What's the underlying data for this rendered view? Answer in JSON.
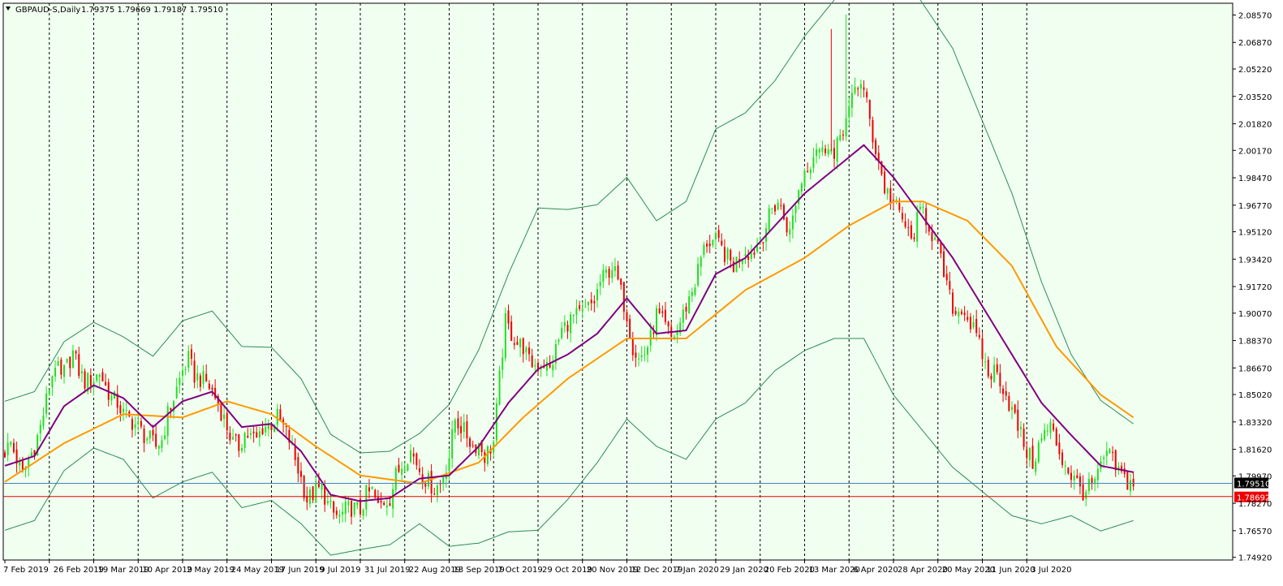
{
  "header": {
    "symbol": "GBPAUD-S,Daily",
    "ohlc": "1.79375 1.79669 1.79187 1.79510"
  },
  "colors": {
    "background": "#F0FFF0",
    "bull": "#22DD22",
    "bear": "#EE0000",
    "ma_fast": "#800080",
    "ma_slow": "#FF9900",
    "bands": "#2E8B57",
    "bid_line": "#4682B4",
    "ask_line": "#EE0000"
  },
  "chart_data": {
    "type": "line",
    "title": "GBPAUD-S,Daily",
    "xlabel": "",
    "ylabel": "",
    "ylim": [
      1.7475,
      2.093
    ],
    "y_ticks": [
      "2.08570",
      "2.06870",
      "2.05220",
      "2.03520",
      "2.01820",
      "2.00170",
      "1.98470",
      "1.96770",
      "1.95120",
      "1.93420",
      "1.91720",
      "1.90070",
      "1.88370",
      "1.86670",
      "1.85020",
      "1.83320",
      "1.81620",
      "1.79970",
      "1.78270",
      "1.76570",
      "1.74920"
    ],
    "x_ticks": [
      "7 Feb 2019",
      "26 Feb 2019",
      "19 Mar 2019",
      "10 Apr 2019",
      "2 May 2019",
      "24 May 2019",
      "17 Jun 2019",
      "9 Jul 2019",
      "31 Jul 2019",
      "22 Aug 2019",
      "13 Sep 2019",
      "7 Oct 2019",
      "29 Oct 2019",
      "20 Nov 2019",
      "12 Dec 2019",
      "7 Jan 2020",
      "29 Jan 2020",
      "20 Feb 2020",
      "13 Mar 2020",
      "6 Apr 2020",
      "28 Apr 2020",
      "20 May 2020",
      "11 Jun 2020",
      "3 Jul 2020"
    ],
    "price_labels": {
      "bid": "1.79510",
      "ask": "1.78692"
    },
    "price_values": {
      "bid": 1.7951,
      "ask": 1.78692
    },
    "grid": "vertical-dashed",
    "candles_per_tick": 15,
    "close_path": [
      [
        0,
        1.815
      ],
      [
        2,
        1.82
      ],
      [
        4,
        1.81
      ],
      [
        6,
        1.8
      ],
      [
        8,
        1.81
      ],
      [
        10,
        1.818
      ],
      [
        12,
        1.83
      ],
      [
        15,
        1.855
      ],
      [
        17,
        1.87
      ],
      [
        19,
        1.86
      ],
      [
        21,
        1.868
      ],
      [
        23,
        1.876
      ],
      [
        25,
        1.865
      ],
      [
        27,
        1.858
      ],
      [
        30,
        1.86
      ],
      [
        32,
        1.864
      ],
      [
        34,
        1.855
      ],
      [
        36,
        1.848
      ],
      [
        38,
        1.845
      ],
      [
        40,
        1.838
      ],
      [
        42,
        1.835
      ],
      [
        45,
        1.83
      ],
      [
        47,
        1.825
      ],
      [
        49,
        1.822
      ],
      [
        51,
        1.818
      ],
      [
        53,
        1.822
      ],
      [
        55,
        1.838
      ],
      [
        57,
        1.848
      ],
      [
        60,
        1.865
      ],
      [
        62,
        1.872
      ],
      [
        64,
        1.862
      ],
      [
        66,
        1.86
      ],
      [
        68,
        1.858
      ],
      [
        70,
        1.852
      ],
      [
        72,
        1.845
      ],
      [
        75,
        1.83
      ],
      [
        77,
        1.82
      ],
      [
        79,
        1.818
      ],
      [
        81,
        1.826
      ],
      [
        83,
        1.824
      ],
      [
        85,
        1.822
      ],
      [
        87,
        1.83
      ],
      [
        90,
        1.832
      ],
      [
        92,
        1.836
      ],
      [
        94,
        1.83
      ],
      [
        96,
        1.822
      ],
      [
        98,
        1.81
      ],
      [
        100,
        1.798
      ],
      [
        102,
        1.785
      ],
      [
        105,
        1.79
      ],
      [
        107,
        1.792
      ],
      [
        109,
        1.782
      ],
      [
        111,
        1.776
      ],
      [
        113,
        1.774
      ],
      [
        115,
        1.778
      ],
      [
        117,
        1.78
      ],
      [
        120,
        1.778
      ],
      [
        122,
        1.788
      ],
      [
        124,
        1.79
      ],
      [
        126,
        1.78
      ],
      [
        128,
        1.784
      ],
      [
        130,
        1.786
      ],
      [
        132,
        1.8
      ],
      [
        135,
        1.81
      ],
      [
        137,
        1.815
      ],
      [
        139,
        1.808
      ],
      [
        141,
        1.8
      ],
      [
        143,
        1.796
      ],
      [
        145,
        1.792
      ],
      [
        147,
        1.795
      ],
      [
        150,
        1.812
      ],
      [
        152,
        1.835
      ],
      [
        154,
        1.83
      ],
      [
        156,
        1.825
      ],
      [
        158,
        1.818
      ],
      [
        160,
        1.82
      ],
      [
        162,
        1.812
      ],
      [
        165,
        1.82
      ],
      [
        167,
        1.86
      ],
      [
        169,
        1.895
      ],
      [
        171,
        1.888
      ],
      [
        173,
        1.882
      ],
      [
        175,
        1.88
      ],
      [
        177,
        1.87
      ],
      [
        180,
        1.868
      ],
      [
        182,
        1.87
      ],
      [
        184,
        1.865
      ],
      [
        186,
        1.878
      ],
      [
        188,
        1.89
      ],
      [
        190,
        1.895
      ],
      [
        192,
        1.898
      ],
      [
        195,
        1.9
      ],
      [
        197,
        1.904
      ],
      [
        199,
        1.908
      ],
      [
        201,
        1.92
      ],
      [
        203,
        1.925
      ],
      [
        205,
        1.93
      ],
      [
        207,
        1.92
      ],
      [
        210,
        1.9
      ],
      [
        212,
        1.88
      ],
      [
        214,
        1.872
      ],
      [
        216,
        1.876
      ],
      [
        218,
        1.885
      ],
      [
        220,
        1.9
      ],
      [
        222,
        1.895
      ],
      [
        225,
        1.885
      ],
      [
        227,
        1.89
      ],
      [
        229,
        1.9
      ],
      [
        231,
        1.91
      ],
      [
        233,
        1.92
      ],
      [
        235,
        1.935
      ],
      [
        237,
        1.945
      ],
      [
        240,
        1.945
      ],
      [
        242,
        1.94
      ],
      [
        244,
        1.935
      ],
      [
        246,
        1.93
      ],
      [
        248,
        1.936
      ],
      [
        250,
        1.94
      ],
      [
        252,
        1.938
      ],
      [
        255,
        1.945
      ],
      [
        257,
        1.955
      ],
      [
        259,
        1.965
      ],
      [
        261,
        1.97
      ],
      [
        263,
        1.96
      ],
      [
        265,
        1.95
      ],
      [
        267,
        1.97
      ],
      [
        270,
        1.99
      ],
      [
        272,
        1.995
      ],
      [
        274,
        2.005
      ],
      [
        276,
        2.0
      ],
      [
        278,
        2.008
      ],
      [
        280,
        1.995
      ],
      [
        282,
        2.012
      ],
      [
        285,
        2.025
      ],
      [
        287,
        2.04
      ],
      [
        289,
        2.045
      ],
      [
        291,
        2.03
      ],
      [
        293,
        2.01
      ],
      [
        295,
        1.995
      ],
      [
        297,
        1.978
      ],
      [
        300,
        1.97
      ],
      [
        302,
        1.962
      ],
      [
        304,
        1.955
      ],
      [
        306,
        1.945
      ],
      [
        308,
        1.958
      ],
      [
        310,
        1.965
      ],
      [
        312,
        1.955
      ],
      [
        315,
        1.94
      ],
      [
        317,
        1.925
      ],
      [
        319,
        1.91
      ],
      [
        321,
        1.9
      ],
      [
        323,
        1.905
      ],
      [
        325,
        1.898
      ],
      [
        327,
        1.89
      ],
      [
        330,
        1.875
      ],
      [
        332,
        1.862
      ],
      [
        334,
        1.865
      ],
      [
        336,
        1.86
      ],
      [
        338,
        1.85
      ],
      [
        340,
        1.84
      ],
      [
        342,
        1.83
      ],
      [
        345,
        1.815
      ],
      [
        347,
        1.808
      ],
      [
        349,
        1.818
      ],
      [
        351,
        1.826
      ],
      [
        353,
        1.83
      ],
      [
        355,
        1.82
      ],
      [
        357,
        1.81
      ],
      [
        360,
        1.8
      ],
      [
        362,
        1.795
      ],
      [
        364,
        1.79
      ],
      [
        366,
        1.792
      ],
      [
        368,
        1.796
      ],
      [
        370,
        1.804
      ],
      [
        372,
        1.815
      ],
      [
        375,
        1.805
      ],
      [
        377,
        1.8
      ],
      [
        379,
        1.796
      ],
      [
        381,
        1.795
      ]
    ],
    "ma_fast_path": [
      [
        0,
        1.806
      ],
      [
        10,
        1.812
      ],
      [
        20,
        1.843
      ],
      [
        30,
        1.856
      ],
      [
        40,
        1.848
      ],
      [
        50,
        1.83
      ],
      [
        60,
        1.846
      ],
      [
        70,
        1.852
      ],
      [
        80,
        1.83
      ],
      [
        90,
        1.832
      ],
      [
        100,
        1.815
      ],
      [
        110,
        1.788
      ],
      [
        120,
        1.784
      ],
      [
        130,
        1.786
      ],
      [
        140,
        1.798
      ],
      [
        150,
        1.8
      ],
      [
        160,
        1.818
      ],
      [
        170,
        1.845
      ],
      [
        180,
        1.866
      ],
      [
        190,
        1.875
      ],
      [
        200,
        1.888
      ],
      [
        210,
        1.91
      ],
      [
        220,
        1.888
      ],
      [
        230,
        1.89
      ],
      [
        240,
        1.925
      ],
      [
        250,
        1.935
      ],
      [
        260,
        1.955
      ],
      [
        270,
        1.975
      ],
      [
        280,
        1.99
      ],
      [
        290,
        2.005
      ],
      [
        300,
        1.985
      ],
      [
        310,
        1.96
      ],
      [
        320,
        1.935
      ],
      [
        330,
        1.905
      ],
      [
        340,
        1.875
      ],
      [
        350,
        1.845
      ],
      [
        360,
        1.825
      ],
      [
        370,
        1.806
      ],
      [
        381,
        1.802
      ]
    ],
    "ma_slow_path": [
      [
        0,
        1.796
      ],
      [
        20,
        1.82
      ],
      [
        40,
        1.838
      ],
      [
        60,
        1.836
      ],
      [
        75,
        1.846
      ],
      [
        90,
        1.838
      ],
      [
        105,
        1.818
      ],
      [
        120,
        1.8
      ],
      [
        140,
        1.795
      ],
      [
        160,
        1.808
      ],
      [
        175,
        1.836
      ],
      [
        190,
        1.86
      ],
      [
        210,
        1.885
      ],
      [
        230,
        1.885
      ],
      [
        250,
        1.915
      ],
      [
        270,
        1.935
      ],
      [
        285,
        1.955
      ],
      [
        300,
        1.97
      ],
      [
        310,
        1.97
      ],
      [
        325,
        1.958
      ],
      [
        340,
        1.93
      ],
      [
        355,
        1.88
      ],
      [
        370,
        1.85
      ],
      [
        381,
        1.836
      ]
    ],
    "band_width_path": [
      [
        0,
        0.04
      ],
      [
        20,
        0.04
      ],
      [
        40,
        0.038
      ],
      [
        60,
        0.05
      ],
      [
        80,
        0.05
      ],
      [
        100,
        0.045
      ],
      [
        120,
        0.03
      ],
      [
        140,
        0.028
      ],
      [
        160,
        0.06
      ],
      [
        180,
        0.1
      ],
      [
        200,
        0.08
      ],
      [
        220,
        0.07
      ],
      [
        240,
        0.09
      ],
      [
        260,
        0.09
      ],
      [
        280,
        0.105
      ],
      [
        300,
        0.135
      ],
      [
        320,
        0.13
      ],
      [
        340,
        0.1
      ],
      [
        360,
        0.05
      ],
      [
        381,
        0.03
      ]
    ],
    "spikes": [
      {
        "index": 279,
        "high": 2.077,
        "direction": "bear"
      },
      {
        "index": 284,
        "high": 2.086,
        "direction": "bull"
      }
    ]
  }
}
